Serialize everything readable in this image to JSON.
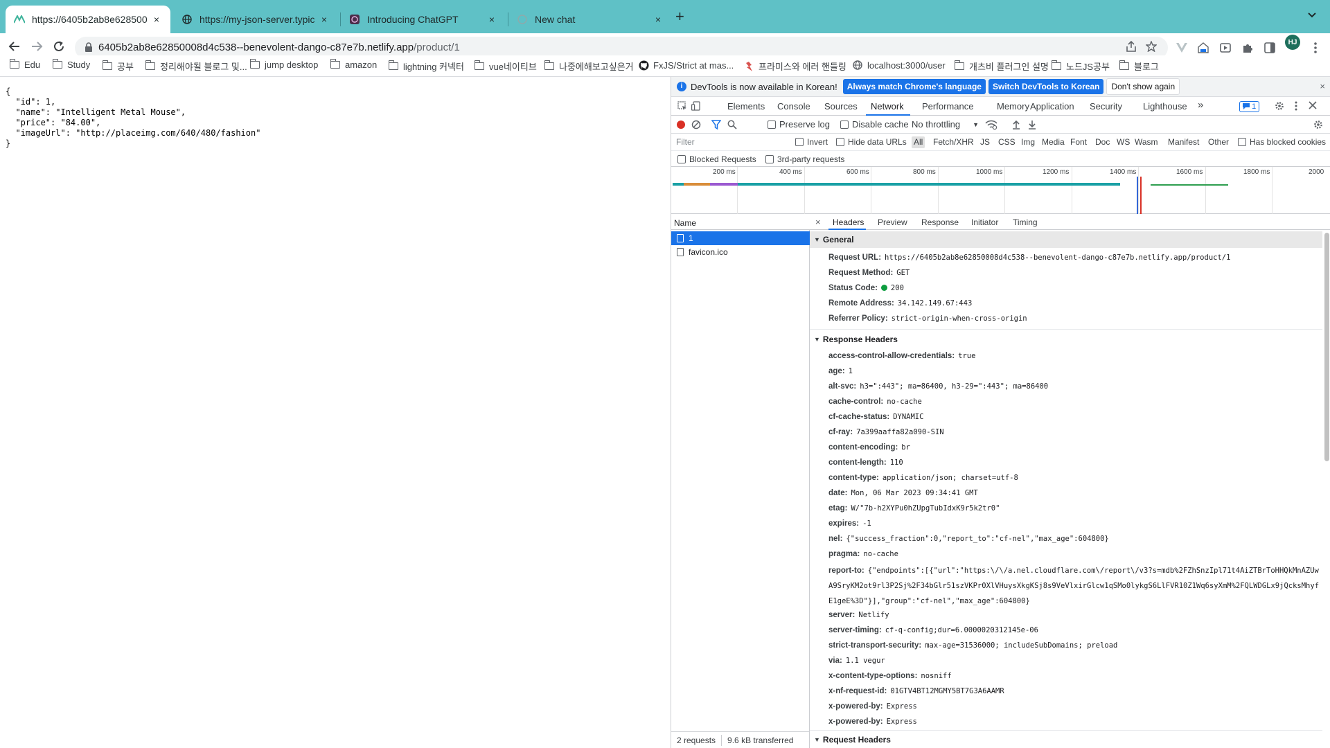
{
  "browser": {
    "tabs": [
      {
        "title": "https://6405b2ab8e6285000 ",
        "active": true
      },
      {
        "title": "https://my-json-server.typicod",
        "active": false
      },
      {
        "title": "Introducing ChatGPT",
        "active": false
      },
      {
        "title": "New chat",
        "active": false
      }
    ],
    "new_tab": "+",
    "close_glyph": "×",
    "url_host": "6405b2ab8e62850008d4c538--benevolent-dango-c87e7b.netlify.app",
    "url_path": "/product/1",
    "profile_initials": "HJ",
    "bookmarks": [
      {
        "label": "Edu",
        "icon": "folder-icon"
      },
      {
        "label": "Study",
        "icon": "folder-icon"
      },
      {
        "label": "공부",
        "icon": "folder-icon"
      },
      {
        "label": "정리해야될 블로그 및...",
        "icon": "folder-icon"
      },
      {
        "label": "jump desktop",
        "icon": "folder-icon"
      },
      {
        "label": "amazon",
        "icon": "folder-icon"
      },
      {
        "label": "lightning 커넥터",
        "icon": "folder-icon"
      },
      {
        "label": "vue네이티브",
        "icon": "folder-icon"
      },
      {
        "label": "나중에해보고싶은거",
        "icon": "folder-icon"
      },
      {
        "label": "FxJS/Strict at mas...",
        "icon": "github-icon"
      },
      {
        "label": "프라미스와 에러 핸들링",
        "icon": "javascript-info-icon"
      },
      {
        "label": "localhost:3000/user",
        "icon": "globe-icon"
      },
      {
        "label": "개츠비 플러그인 설명",
        "icon": "folder-icon"
      },
      {
        "label": "노드JS공부",
        "icon": "folder-icon"
      },
      {
        "label": "블로그",
        "icon": "folder-icon"
      }
    ]
  },
  "page": {
    "json_text": "{\n  \"id\": 1,\n  \"name\": \"Intelligent Metal Mouse\",\n  \"price\": \"84.00\",\n  \"imageUrl\": \"http://placeimg.com/640/480/fashion\"\n}"
  },
  "devtools": {
    "infobar": {
      "message": "DevTools is now available in Korean!",
      "btn_match": "Always match Chrome's language",
      "btn_switch": "Switch DevTools to Korean",
      "btn_dismiss": "Don't show again",
      "close": "×"
    },
    "tabs": [
      "Elements",
      "Console",
      "Sources",
      "Network",
      "Performance",
      "Memory",
      "Application",
      "Security",
      "Lighthouse"
    ],
    "active_tab": "Network",
    "more_tabs": "»",
    "issues_count": "1",
    "network_toolbar": {
      "preserve_log": "Preserve log",
      "disable_cache": "Disable cache",
      "throttling": "No throttling"
    },
    "filter": {
      "placeholder": "Filter",
      "invert": "Invert",
      "hide_data_urls": "Hide data URLs",
      "types": [
        "All",
        "Fetch/XHR",
        "JS",
        "CSS",
        "Img",
        "Media",
        "Font",
        "Doc",
        "WS",
        "Wasm",
        "Manifest",
        "Other"
      ],
      "active_type": "All",
      "has_blocked_cookies": "Has blocked cookies",
      "blocked_requests": "Blocked Requests",
      "third_party": "3rd-party requests"
    },
    "overview_ticks": [
      "200 ms",
      "400 ms",
      "600 ms",
      "800 ms",
      "1000 ms",
      "1200 ms",
      "1400 ms",
      "1600 ms",
      "1800 ms",
      "2000"
    ],
    "requests": {
      "column_name": "Name",
      "rows": [
        "1",
        "favicon.ico"
      ],
      "selected": "1",
      "summary_requests": "2 requests",
      "summary_transferred": "9.6 kB transferred"
    },
    "detail_tabs": [
      "Headers",
      "Preview",
      "Response",
      "Initiator",
      "Timing"
    ],
    "active_detail_tab": "Headers",
    "general": {
      "title": "General",
      "rows": [
        {
          "k": "Request URL:",
          "v": "https://6405b2ab8e62850008d4c538--benevolent-dango-c87e7b.netlify.app/product/1"
        },
        {
          "k": "Request Method:",
          "v": "GET"
        },
        {
          "k": "Status Code:",
          "v": "200",
          "status_color": "#0d9d3f"
        },
        {
          "k": "Remote Address:",
          "v": "34.142.149.67:443"
        },
        {
          "k": "Referrer Policy:",
          "v": "strict-origin-when-cross-origin"
        }
      ]
    },
    "response_headers": {
      "title": "Response Headers",
      "rows": [
        {
          "k": "access-control-allow-credentials:",
          "v": "true"
        },
        {
          "k": "age:",
          "v": "1"
        },
        {
          "k": "alt-svc:",
          "v": "h3=\":443\"; ma=86400, h3-29=\":443\"; ma=86400"
        },
        {
          "k": "cache-control:",
          "v": "no-cache"
        },
        {
          "k": "cf-cache-status:",
          "v": "DYNAMIC"
        },
        {
          "k": "cf-ray:",
          "v": "7a399aaffa82a090-SIN"
        },
        {
          "k": "content-encoding:",
          "v": "br"
        },
        {
          "k": "content-length:",
          "v": "110"
        },
        {
          "k": "content-type:",
          "v": "application/json; charset=utf-8"
        },
        {
          "k": "date:",
          "v": "Mon, 06 Mar 2023 09:34:41 GMT"
        },
        {
          "k": "etag:",
          "v": "W/\"7b-h2XYPu0hZUpgTubIdxK9r5k2tr0\""
        },
        {
          "k": "expires:",
          "v": "-1"
        },
        {
          "k": "nel:",
          "v": "{\"success_fraction\":0,\"report_to\":\"cf-nel\",\"max_age\":604800}"
        },
        {
          "k": "pragma:",
          "v": "no-cache"
        },
        {
          "k": "report-to:",
          "v": "{\"endpoints\":[{\"url\":\"https:\\/\\/a.nel.cloudflare.com\\/report\\/v3?s=mdb%2FZhSnzIpl71t4AiZTBrToHHQkMnAZUwA9SryKM2ot9rl3P2Sj%2F34bGlr51szVKPr0XlVHuysXkgKSj8s9VeVlxirGlcw1qSMo0lykgS6LlFVR10Z1Wq6syXmM%2FQLWDGLx9jQcksMhyfE1geE%3D\"}],\"group\":\"cf-nel\",\"max_age\":604800}"
        },
        {
          "k": "server:",
          "v": "Netlify"
        },
        {
          "k": "server-timing:",
          "v": "cf-q-config;dur=6.0000020312145e-06"
        },
        {
          "k": "strict-transport-security:",
          "v": "max-age=31536000; includeSubDomains; preload"
        },
        {
          "k": "via:",
          "v": "1.1 vegur"
        },
        {
          "k": "x-content-type-options:",
          "v": "nosniff"
        },
        {
          "k": "x-nf-request-id:",
          "v": "01GTV4BT12MGMY5BT7G3A6AAMR"
        },
        {
          "k": "x-powered-by:",
          "v": "Express"
        }
      ]
    },
    "request_headers": {
      "title": "Request Headers"
    }
  },
  "colors": {
    "tabstrip": "#5fc1c6",
    "accent": "#1a73e8",
    "record": "#d93025",
    "status_ok": "#0d9d3f"
  }
}
